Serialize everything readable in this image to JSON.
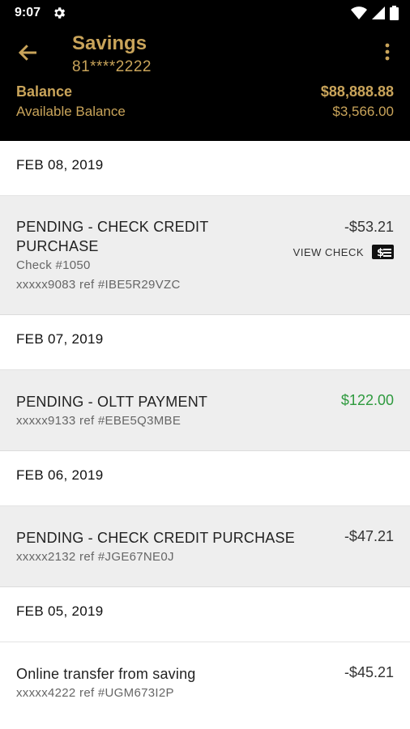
{
  "status_bar": {
    "time": "9:07"
  },
  "header": {
    "title": "Savings",
    "account_number": "81****2222",
    "balance_label": "Balance",
    "balance_value": "$88,888.88",
    "available_label": "Available Balance",
    "available_value": "$3,566.00"
  },
  "colors": {
    "accent_gold": "#c9a45a",
    "credit_green": "#2e9a3e",
    "header_bg": "#000000",
    "row_bg": "#eeeeee"
  },
  "groups": [
    {
      "date": "FEB 08, 2019",
      "txn": {
        "line1": "PENDING - CHECK CREDIT",
        "line2": "PURCHASE",
        "check": "Check #1050",
        "ref": "xxxxx9083 ref #IBE5R29VZC",
        "amount": "-$53.21",
        "action": "VIEW CHECK"
      }
    },
    {
      "date": "FEB 07, 2019",
      "txn": {
        "line1": "PENDING - OLTT PAYMENT",
        "ref": "xxxxx9133 ref #EBE5Q3MBE",
        "amount": "$122.00"
      }
    },
    {
      "date": "FEB 06, 2019",
      "txn": {
        "line1": "PENDING - CHECK CREDIT PURCHASE",
        "ref": "xxxxx2132 ref #JGE67NE0J",
        "amount": "-$47.21"
      }
    },
    {
      "date": "FEB 05, 2019",
      "txn": {
        "line1": "Online transfer from saving",
        "ref": "xxxxx4222 ref #UGM673I2P",
        "amount": "-$45.21"
      }
    }
  ]
}
